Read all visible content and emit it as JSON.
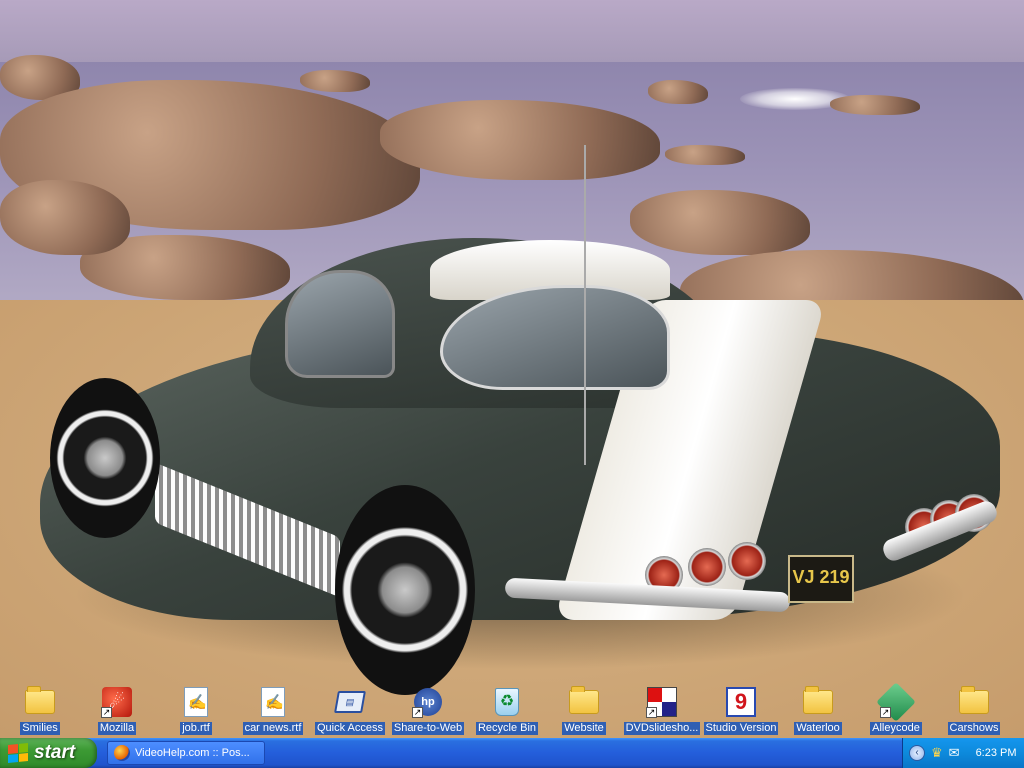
{
  "desktop": {
    "icons": [
      {
        "label": "Smilies",
        "icon": "folder-icon"
      },
      {
        "label": "Mozilla",
        "icon": "mozilla-icon"
      },
      {
        "label": "job.rtf",
        "icon": "rtf-document-icon"
      },
      {
        "label": "car news.rtf",
        "icon": "rtf-document-icon"
      },
      {
        "label": "Quick Access",
        "icon": "quick-access-icon"
      },
      {
        "label": "Share-to-Web",
        "icon": "hp-share-icon"
      },
      {
        "label": "Recycle Bin",
        "icon": "recycle-bin-icon"
      },
      {
        "label": "Website",
        "icon": "folder-icon"
      },
      {
        "label": "DVDslidesho...",
        "icon": "dvd-slideshow-icon"
      },
      {
        "label": "Studio Version",
        "icon": "studio-version-icon"
      },
      {
        "label": "Waterloo",
        "icon": "folder-icon"
      },
      {
        "label": "Alleycode",
        "icon": "alleycode-icon"
      },
      {
        "label": "Carshows",
        "icon": "folder-icon"
      }
    ],
    "wallpaper": {
      "plate_text": "VJ 219"
    }
  },
  "taskbar": {
    "start_label": "start",
    "tasks": [
      {
        "label": "VideoHelp.com :: Pos...",
        "icon": "firefox-icon"
      }
    ],
    "tray": {
      "time": "6:23 PM"
    }
  },
  "colors": {
    "taskbar": "#245edb",
    "start_button": "#3c9a34",
    "tray": "#0d8adc",
    "icon_label_bg": "#2f5fb3"
  }
}
